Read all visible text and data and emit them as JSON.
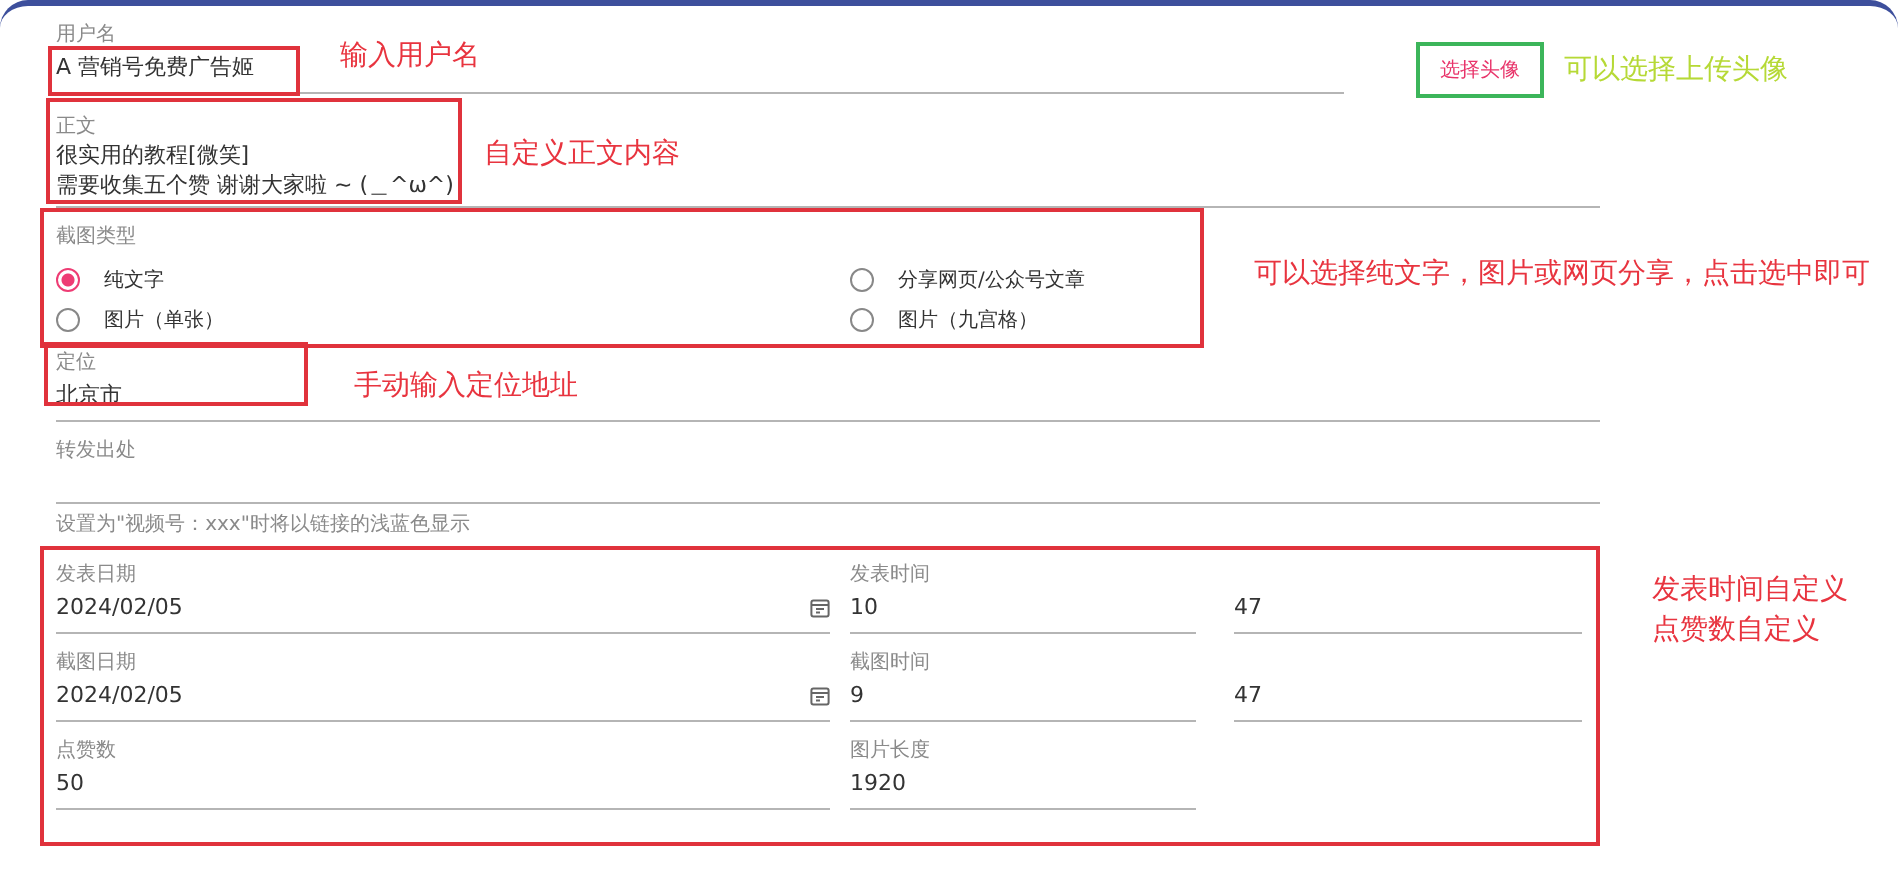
{
  "username": {
    "label": "用户名",
    "value": "A 营销号免费广告姬",
    "highlighted": true,
    "note": {
      "text": "输入用户名",
      "color": "#e8343f"
    }
  },
  "avatar": {
    "button": "选择头像",
    "note": {
      "text": "可以选择上传头像",
      "color": "#b6d936"
    }
  },
  "body": {
    "label": "正文",
    "lines": [
      "很实用的教程[微笑]",
      "需要收集五个赞 谢谢大家啦 ~ (＿^ω^)"
    ],
    "highlighted": true,
    "note": {
      "text": "自定义正文内容",
      "color": "#e8343f"
    }
  },
  "screenshot_type": {
    "label": "截图类型",
    "highlighted": true,
    "note": {
      "text": "可以选择纯文字，图片或网页分享，点击选中即可",
      "color": "#e8343f"
    },
    "options": [
      {
        "label": "纯文字",
        "selected": true
      },
      {
        "label": "分享网页/公众号文章",
        "selected": false
      },
      {
        "label": "图片（单张）",
        "selected": false
      },
      {
        "label": "图片（九宫格）",
        "selected": false
      }
    ]
  },
  "location": {
    "label": "定位",
    "value": "北京市",
    "highlighted": true,
    "note": {
      "text": "手动输入定位地址",
      "color": "#e8343f"
    }
  },
  "forward_source": {
    "label": "转发出处",
    "hint": "设置为\"视频号：xxx\"时将以链接的浅蓝色显示"
  },
  "time_fields": {
    "highlighted": true,
    "note": {
      "lines": [
        "发表时间自定义",
        "点赞数自定义"
      ],
      "color": "#e8343f"
    },
    "rows": [
      [
        {
          "label": "发表日期",
          "value": "2024/02/05",
          "kind": "date"
        },
        {
          "label": "发表时间",
          "value": "10",
          "kind": "text"
        },
        {
          "value": "47",
          "kind": "text"
        }
      ],
      [
        {
          "label": "截图日期",
          "value": "2024/02/05",
          "kind": "date"
        },
        {
          "label": "截图时间",
          "value": "9",
          "kind": "text"
        },
        {
          "value": "47",
          "kind": "text"
        }
      ],
      [
        {
          "label": "点赞数",
          "value": "50",
          "kind": "text"
        },
        {
          "label": "图片长度",
          "value": "1920",
          "kind": "text"
        }
      ]
    ]
  }
}
